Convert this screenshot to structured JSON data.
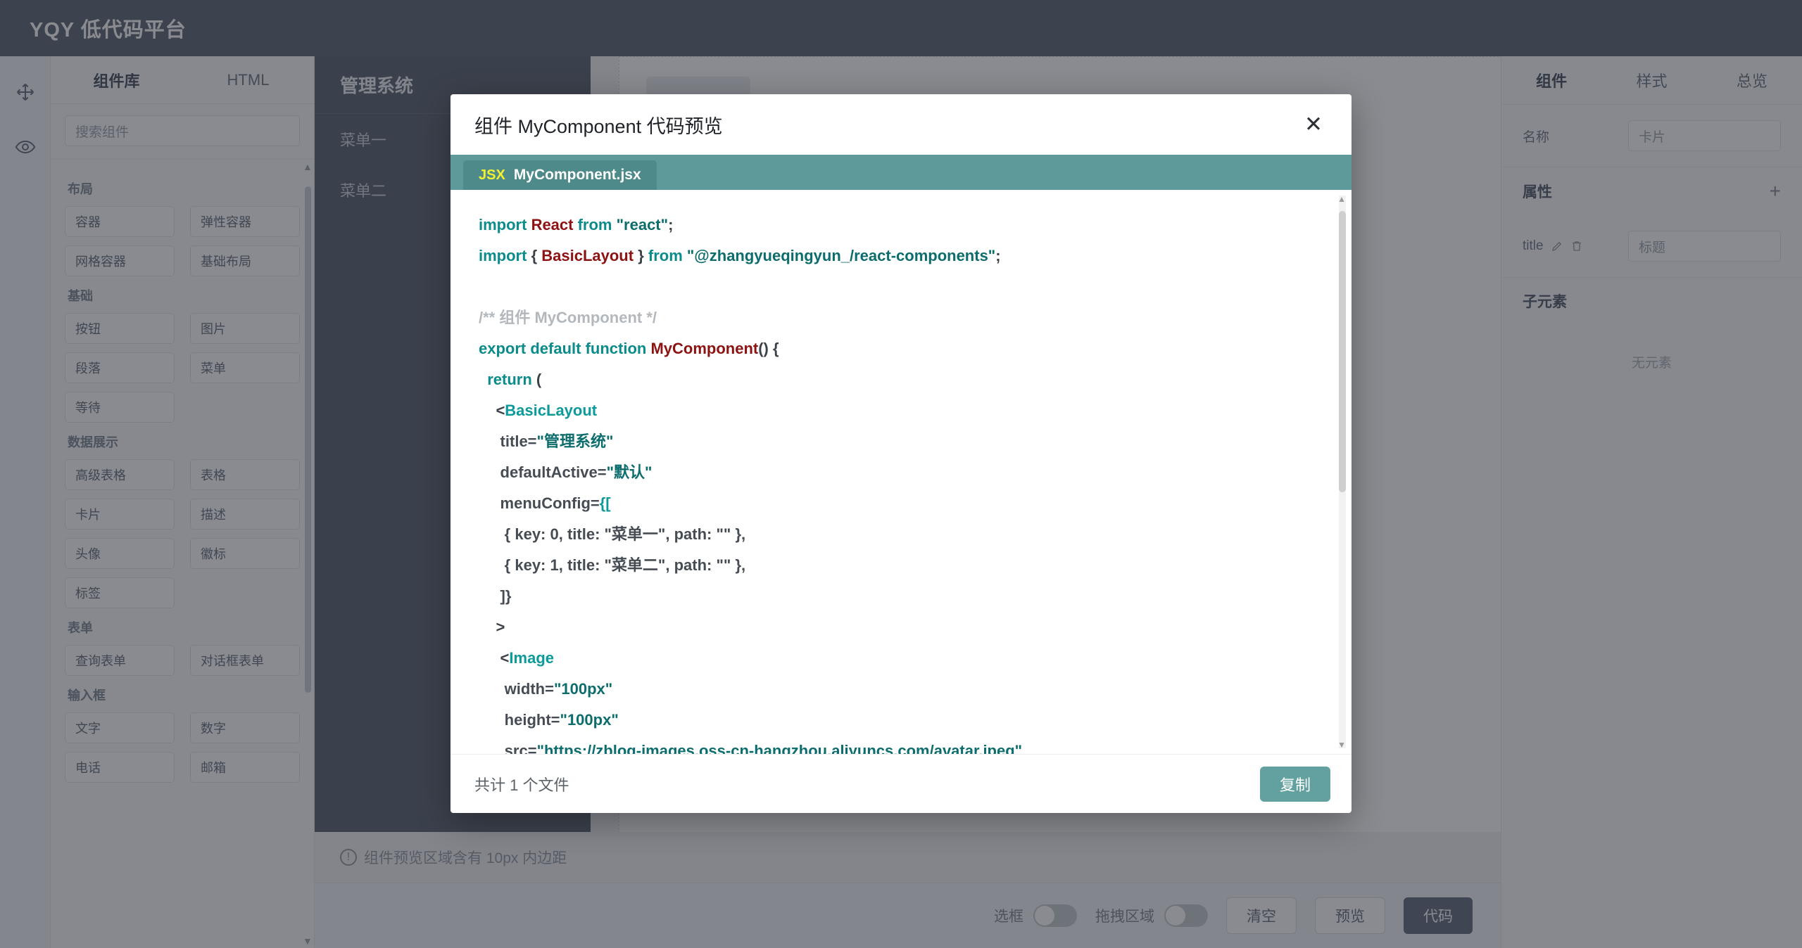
{
  "app": {
    "title": "YQY 低代码平台"
  },
  "left_panel": {
    "tabs": [
      {
        "label": "组件库",
        "active": true
      },
      {
        "label": "HTML",
        "active": false
      }
    ],
    "search_placeholder": "搜索组件",
    "groups": [
      {
        "title": "布局",
        "items": [
          "容器",
          "弹性容器",
          "网格容器",
          "基础布局"
        ]
      },
      {
        "title": "基础",
        "items": [
          "按钮",
          "图片",
          "段落",
          "菜单",
          "等待"
        ]
      },
      {
        "title": "数据展示",
        "items": [
          "高级表格",
          "表格",
          "卡片",
          "描述",
          "头像",
          "徽标",
          "标签"
        ]
      },
      {
        "title": "表单",
        "items": [
          "查询表单",
          "对话框表单"
        ]
      },
      {
        "title": "输入框",
        "items": [
          "文字",
          "数字",
          "电话",
          "邮箱"
        ]
      }
    ]
  },
  "canvas": {
    "preview": {
      "sider_title": "管理系统",
      "menu_items": [
        "菜单一",
        "菜单二"
      ]
    },
    "hint": "组件预览区域含有 10px 内边距",
    "hint_icon": "info-circle-icon"
  },
  "bottom_bar": {
    "toggles": [
      {
        "label": "选框",
        "on": false
      },
      {
        "label": "拖拽区域",
        "on": false
      }
    ],
    "buttons": [
      {
        "label": "清空",
        "kind": "ghost"
      },
      {
        "label": "预览",
        "kind": "ghost"
      },
      {
        "label": "代码",
        "kind": "primary"
      }
    ]
  },
  "right_panel": {
    "tabs": [
      {
        "label": "组件",
        "active": true
      },
      {
        "label": "样式",
        "active": false
      },
      {
        "label": "总览",
        "active": false
      }
    ],
    "name_label": "名称",
    "name_value": "卡片",
    "props_section": "属性",
    "props_add_icon": "plus-icon",
    "prop_rows": [
      {
        "key": "title",
        "edit_icon": "pencil-icon",
        "delete_icon": "trash-icon",
        "value": "标题"
      }
    ],
    "children_section": "子元素",
    "children_empty": "无元素"
  },
  "modal": {
    "title": "组件 MyComponent 代码预览",
    "close_icon": "close-icon",
    "tab": {
      "badge": "JSX",
      "filename": "MyComponent.jsx"
    },
    "footer_count": "共计 1 个文件",
    "copy_label": "复制",
    "code_lines": [
      [
        {
          "t": "import ",
          "c": "kw"
        },
        {
          "t": "React ",
          "c": "name"
        },
        {
          "t": "from ",
          "c": "kw"
        },
        {
          "t": "\"react\"",
          "c": "str"
        },
        {
          "t": ";",
          "c": "punc"
        }
      ],
      [
        {
          "t": "import ",
          "c": "kw"
        },
        {
          "t": "{ ",
          "c": "punc"
        },
        {
          "t": "BasicLayout",
          "c": "name"
        },
        {
          "t": " } ",
          "c": "punc"
        },
        {
          "t": "from ",
          "c": "kw"
        },
        {
          "t": "\"@zhangyueqingyun_/react-components\"",
          "c": "str"
        },
        {
          "t": ";",
          "c": "punc"
        }
      ],
      [
        {
          "t": "",
          "c": "plain"
        }
      ],
      [
        {
          "t": "/** 组件 MyComponent */",
          "c": "cmt"
        }
      ],
      [
        {
          "t": "export ",
          "c": "kw"
        },
        {
          "t": "default ",
          "c": "kw"
        },
        {
          "t": "function ",
          "c": "kw"
        },
        {
          "t": "MyComponent",
          "c": "name"
        },
        {
          "t": "() {",
          "c": "punc"
        }
      ],
      [
        {
          "t": "  ",
          "c": "plain"
        },
        {
          "t": "return ",
          "c": "kw"
        },
        {
          "t": "(",
          "c": "punc"
        }
      ],
      [
        {
          "t": "    <",
          "c": "punc"
        },
        {
          "t": "BasicLayout",
          "c": "tag"
        }
      ],
      [
        {
          "t": "     title=",
          "c": "plain"
        },
        {
          "t": "\"管理系统\"",
          "c": "str"
        }
      ],
      [
        {
          "t": "     defaultActive=",
          "c": "plain"
        },
        {
          "t": "\"默认\"",
          "c": "str"
        }
      ],
      [
        {
          "t": "     menuConfig=",
          "c": "plain"
        },
        {
          "t": "{[",
          "c": "tag"
        }
      ],
      [
        {
          "t": "      { key: 0, title: \"菜单一\", path: \"\" },",
          "c": "plain"
        }
      ],
      [
        {
          "t": "      { key: 1, title: \"菜单二\", path: \"\" },",
          "c": "plain"
        }
      ],
      [
        {
          "t": "     ]}",
          "c": "plain"
        }
      ],
      [
        {
          "t": "    >",
          "c": "punc"
        }
      ],
      [
        {
          "t": "     <",
          "c": "punc"
        },
        {
          "t": "Image",
          "c": "tag"
        }
      ],
      [
        {
          "t": "      width=",
          "c": "plain"
        },
        {
          "t": "\"100px\"",
          "c": "str"
        }
      ],
      [
        {
          "t": "      height=",
          "c": "plain"
        },
        {
          "t": "\"100px\"",
          "c": "str"
        }
      ],
      [
        {
          "t": "      src=",
          "c": "plain"
        },
        {
          "t": "\"https://zblog-images.oss-cn-hangzhou.aliyuncs.com/avatar.jpeg\"",
          "c": "str"
        }
      ]
    ]
  },
  "colors": {
    "topbar": "#58606e",
    "tab_bar": "#5e9a9a",
    "file_tab": "#4f8a8a",
    "copy_button": "#63a0a0",
    "jsx_badge": "#f5f02f",
    "keyword": "#0c8b8b",
    "identifier": "#8d1212",
    "string": "#0d6d6d",
    "comment": "#b3b8bd"
  }
}
